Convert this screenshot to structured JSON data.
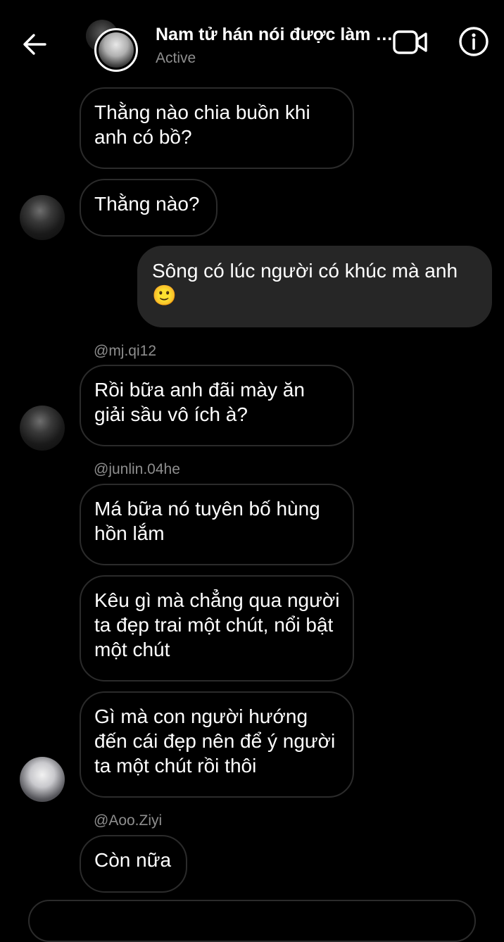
{
  "header": {
    "title": "Nam tử hán nói được làm đ...",
    "status": "Active",
    "back_icon": "arrow-left-icon",
    "video_icon": "video-camera-icon",
    "info_icon": "info-circle-icon"
  },
  "messages": [
    {
      "text": "Thằng nào chia buồn khi anh có bồ?"
    },
    {
      "text": "Thằng nào?"
    },
    {
      "text": "Sông có lúc người có khúc mà anh 🙂"
    },
    {
      "sender": "@mj.qi12",
      "text": "Rồi bữa anh đãi mày ăn giải sầu vô ích à?"
    },
    {
      "sender": "@junlin.04he",
      "text": "Má bữa nó tuyên bố hùng hồn lắm"
    },
    {
      "text": "Kêu gì mà chẳng qua người ta đẹp trai một chút, nổi bật một chút"
    },
    {
      "text": "Gì mà con người hướng đến cái đẹp nên để ý người ta một chút rồi thôi"
    },
    {
      "sender": "@Aoo.Ziyi",
      "text": "Còn nữa"
    }
  ],
  "colors": {
    "background": "#000000",
    "bubble_border": "#2b2b2b",
    "outgoing_bubble": "#262626",
    "secondary_text": "#8e8e8e"
  }
}
